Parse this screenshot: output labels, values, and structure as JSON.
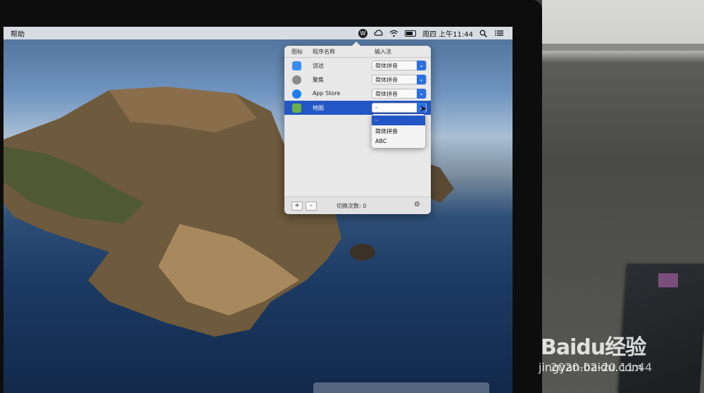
{
  "menubar": {
    "help_label": "帮助",
    "clock": "周四 上午11:44",
    "icons": [
      "app-w-icon",
      "creative-cloud-icon",
      "wifi-icon",
      "battery-icon",
      "search-icon",
      "list-icon"
    ],
    "app_icon_glyph": "W"
  },
  "popover": {
    "headers": {
      "icon": "图标",
      "name": "程序名称",
      "input": "输入法"
    },
    "rows": [
      {
        "name": "访达",
        "input": "简体拼音",
        "icon": "finder-icon",
        "color": "#3a8df0"
      },
      {
        "name": "聚焦",
        "input": "简体拼音",
        "icon": "spotlight-icon",
        "color": "#8a8a8a"
      },
      {
        "name": "App Store",
        "input": "简体拼音",
        "icon": "app-store-icon",
        "color": "#1e7ef0"
      },
      {
        "name": "地图",
        "input": "-",
        "icon": "maps-icon",
        "color": "#6ab04c"
      }
    ],
    "dropdown_options": [
      "-",
      "简体拼音",
      "ABC"
    ],
    "footer": {
      "add": "+",
      "remove": "-",
      "switch_count": "切换次数: 0",
      "gear": "⚙"
    }
  },
  "watermark": {
    "logo": "Baidu经验",
    "url": "jingyan.baidu.com"
  },
  "overlay_time": "2020-02-20 11:44",
  "colors": {
    "accent": "#2357c5",
    "select_arrow": "#2c6fe0"
  }
}
